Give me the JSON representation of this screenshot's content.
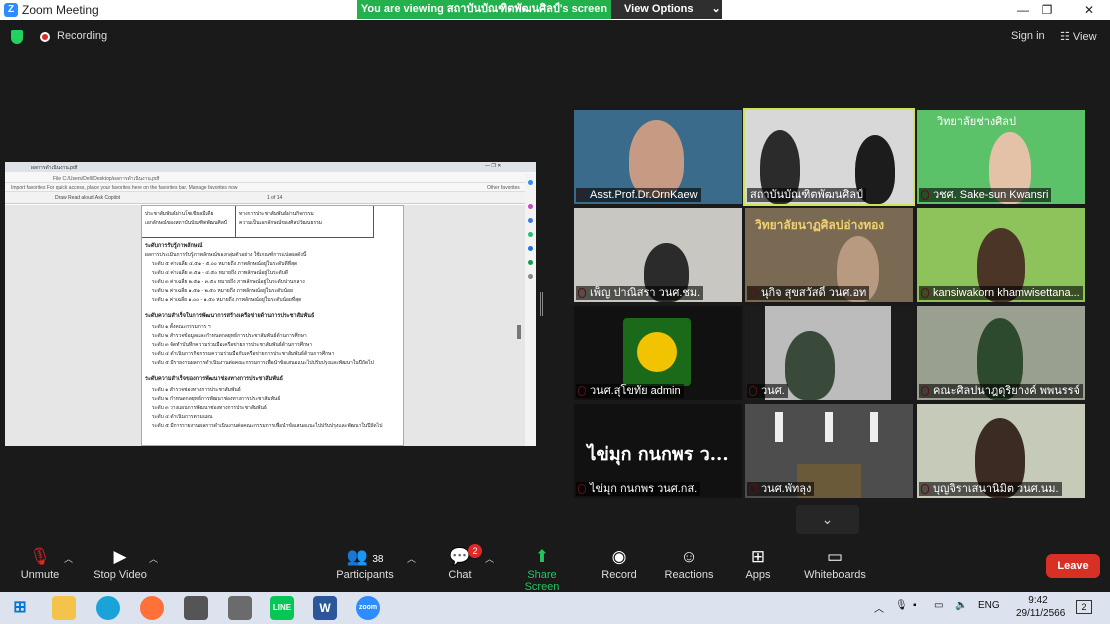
{
  "window": {
    "title": "Zoom Meeting",
    "logo": "Z",
    "controls": [
      "—",
      "❐",
      "✕"
    ]
  },
  "banner": {
    "message": "You are viewing สถาบันบัณฑิตพัฒนศิลป์'s screen",
    "options": "View Options",
    "options_icon": "chevron-down-icon"
  },
  "topbar": {
    "recording": "Recording",
    "signin": "Sign in",
    "view": "View"
  },
  "shared": {
    "tab_title": "ผลการดำเนินงาน.pdf",
    "url": "File   C:/Users/Dell/Desktop/ผลการดำเนินงาน.pdf",
    "favbar": "Import favorites   For quick access, place your favorites here on the favorites bar. Manage favorites now",
    "other_fav": "Other favorites",
    "toolbar": "Draw   Read aloud   Ask Copilot",
    "page_of": "1 of 14",
    "cell1": "ประชาสัมพันธ์ผ่านโซเชียลมีเดีย",
    "cell2": "ทางการประชาสัมพันธ์ผ่านกิจกรรม",
    "cell3": "เอกลักษณ์ของสถาบันบัณฑิตพัฒนศิลป์",
    "cell4": "ความเป็นเอกลักษณ์ของศิลปวัฒนธรรม",
    "h1": "ระดับการรับรู้ภาพลักษณ์",
    "p1": "ผลการประเมินการรับรู้ภาพลักษณ์ของกลุ่มตัวอย่าง ใช้เกณฑ์การแปลผลดังนี้",
    "l1": "ระดับ ๕ ค่าเฉลี่ย ๔.๕๑ - ๕.๐๐ หมายถึง ภาพลักษณ์อยู่ในระดับดีที่สุด",
    "l2": "ระดับ ๔ ค่าเฉลี่ย ๓.๕๑ - ๔.๕๐ หมายถึง ภาพลักษณ์อยู่ในระดับดี",
    "l3": "ระดับ ๓ ค่าเฉลี่ย ๒.๕๑ - ๓.๕๐ หมายถึง ภาพลักษณ์อยู่ในระดับปานกลาง",
    "l4": "ระดับ ๒ ค่าเฉลี่ย ๑.๕๑ - ๒.๕๐ หมายถึง ภาพลักษณ์อยู่ในระดับน้อย",
    "l5": "ระดับ ๑ ค่าเฉลี่ย ๑.๐๐ - ๑.๕๐ หมายถึง ภาพลักษณ์อยู่ในระดับน้อยที่สุด",
    "h2": "ระดับความสำเร็จในการพัฒนาการสร้างเครือข่ายด้านการประชาสัมพันธ์",
    "m1": "ระดับ ๑ ตั้งคณะกรรมการ ฯ",
    "m2": "ระดับ ๒ สำรวจข้อมูลและกำหนดกลยุทธ์การประชาสัมพันธ์ด้านการศึกษา",
    "m3": "ระดับ ๓ จัดทำบันทึกความร่วมมือเครือข่ายการประชาสัมพันธ์ด้านการศึกษา",
    "m4": "ระดับ ๔ ดำเนินการกิจกรรมความร่วมมือกับเครือข่ายการประชาสัมพันธ์ด้านการศึกษา",
    "m5": "ระดับ ๕ มีรายงานผลการดำเนินงานต่อคณะกรรมการเพื่อนำข้อเสนอแนะไปปรับปรุงและพัฒนาในปีถัดไป",
    "h3": "ระดับความสำเร็จของการพัฒนาช่องทางการประชาสัมพันธ์",
    "n1": "ระดับ ๑ สำรวจช่องทางการประชาสัมพันธ์",
    "n2": "ระดับ ๒ กำหนดกลยุทธ์การพัฒนาช่องทางการประชาสัมพันธ์",
    "n3": "ระดับ ๓ วางแผนการพัฒนาช่องทางการประชาสัมพันธ์",
    "n4": "ระดับ ๔ ดำเนินการตามแผน",
    "n5": "ระดับ ๕ มีการรายงานผลการดำเนินงานต่อคณะกรรมการเพื่อนำข้อเสนอแนะไปปรับปรุงและพัฒนาในปีถัดไป"
  },
  "participants": [
    {
      "name": "Asst.Prof.Dr.OrnKaew"
    },
    {
      "name": "สถาบันบัณฑิตพัฒนศิลป์"
    },
    {
      "name": "วชศ. Sake-sun Kwansri",
      "sign": "วิทยาลัยช่างศิลป"
    },
    {
      "name": "เพ็ญ ปาณิสรา วนศ.ชม."
    },
    {
      "name": "นุกิจ สุขสวัสดิ์ วนศ.อท",
      "sign": "วิทยาลัยนาฏศิลปอ่างทอง"
    },
    {
      "name": "kansiwakorn khamwisettana..."
    },
    {
      "name": "วนศ.สุโขทัย admin"
    },
    {
      "name": "วนศ."
    },
    {
      "name": "คณะศิลปนาฎดุริยางค์ พพนรรจ์"
    },
    {
      "name": "ไข่มุก กนกพร วนศ.กส.",
      "big": "ไข่มุก กนกพร ว..."
    },
    {
      "name": "วนศ.พัทลุง"
    },
    {
      "name": "บุญจิราเสนานิมิต วนศ.นม."
    }
  ],
  "controls": {
    "unmute": "Unmute",
    "stop_video": "Stop Video",
    "participants": "Participants",
    "participants_count": "38",
    "chat": "Chat",
    "chat_badge": "2",
    "share": "Share Screen",
    "record": "Record",
    "reactions": "Reactions",
    "apps": "Apps",
    "whiteboards": "Whiteboards",
    "leave": "Leave"
  },
  "taskbar": {
    "lang": "ENG",
    "time": "9:42",
    "date": "29/11/2566",
    "notif": "2",
    "apps": [
      "explorer",
      "edge",
      "firefox",
      "camera",
      "calculator",
      "LINE",
      "Word",
      "zoom"
    ]
  },
  "colors": {
    "banner_green": "#22b14c",
    "leave_red": "#d93025",
    "active_outline": "#cde35a",
    "share_green": "#22c55e"
  }
}
